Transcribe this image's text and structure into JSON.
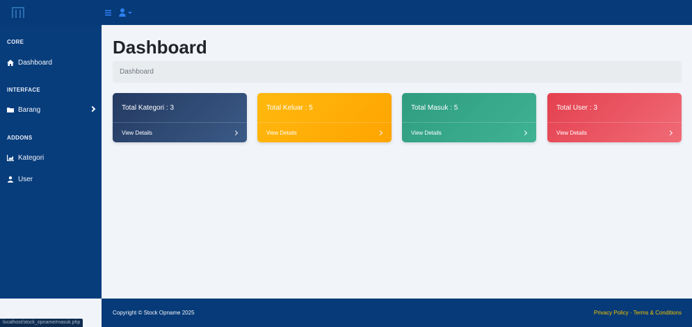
{
  "topbar": {
    "toggle_icon": "bars-icon",
    "user_icon": "user-icon"
  },
  "sidebar": {
    "sections": [
      {
        "heading": "CORE"
      },
      {
        "heading": "INTERFACE"
      },
      {
        "heading": "ADDONS"
      }
    ],
    "items": [
      {
        "label": "Dashboard",
        "icon": "home-icon"
      },
      {
        "label": "Barang",
        "icon": "folder-icon"
      },
      {
        "label": "Kategori",
        "icon": "chart-area-icon"
      },
      {
        "label": "User",
        "icon": "user-icon"
      }
    ]
  },
  "main": {
    "title": "Dashboard",
    "breadcrumb": "Dashboard",
    "cards": [
      {
        "title": "Total Kategori : 3",
        "link": "View Details",
        "color": "#2f4a72"
      },
      {
        "title": "Total Keluar : 5",
        "link": "View Details",
        "color": "#ffab00"
      },
      {
        "title": "Total Masuk : 5",
        "link": "View Details",
        "color": "#35a98a"
      },
      {
        "title": "Total User : 3",
        "link": "View Details",
        "color": "#ea5461"
      }
    ]
  },
  "footer": {
    "copyright": "Copyright © Stock Opname 2025",
    "privacy": "Privacy Policy",
    "separator": "·",
    "terms": "Terms & Conditions"
  },
  "status_url": "localhost/stock_opname/masuk.php"
}
